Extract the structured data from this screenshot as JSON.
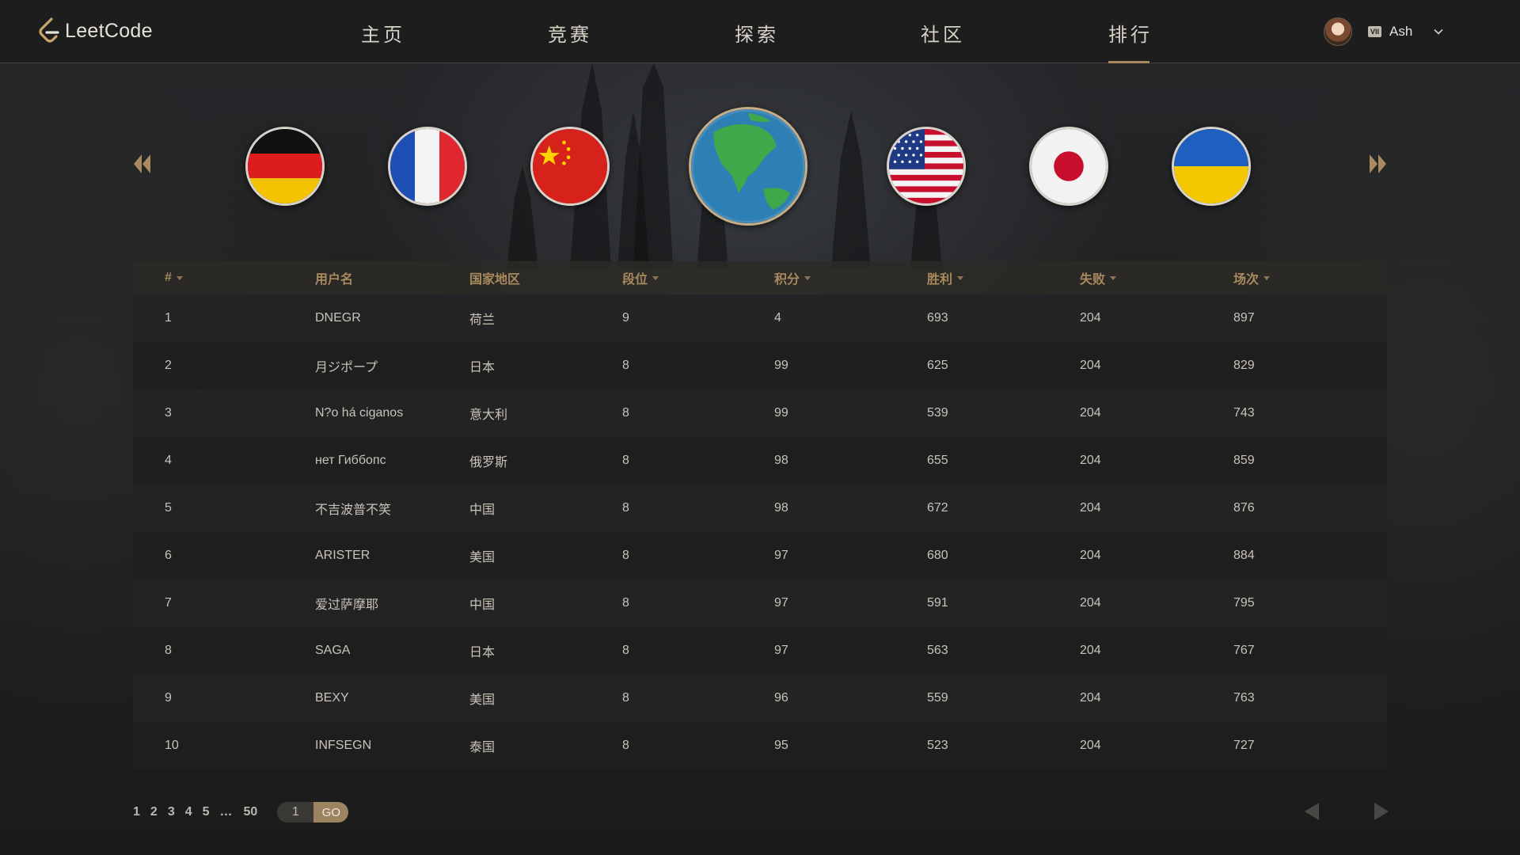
{
  "brand": {
    "name": "LeetCode",
    "accent": "#a88a5e"
  },
  "nav": {
    "items": [
      {
        "label": "主页"
      },
      {
        "label": "竞赛"
      },
      {
        "label": "探索"
      },
      {
        "label": "社区"
      },
      {
        "label": "排行",
        "active": true
      }
    ]
  },
  "user": {
    "badge": "VII",
    "name": "Ash"
  },
  "regions": [
    "germany-flag",
    "france-flag",
    "china-flag",
    "globe",
    "usa-flag",
    "japan-flag",
    "ukraine-flag"
  ],
  "table": {
    "headers": [
      "#",
      "用户名",
      "国家地区",
      "段位",
      "积分",
      "胜利",
      "失败",
      "场次"
    ],
    "rows": [
      [
        "1",
        "DNEGR",
        "荷兰",
        "9",
        "4",
        "693",
        "204",
        "897"
      ],
      [
        "2",
        "月ジポープ",
        "日本",
        "8",
        "99",
        "625",
        "204",
        "829"
      ],
      [
        "3",
        "N?o há ciganos",
        "意大利",
        "8",
        "99",
        "539",
        "204",
        "743"
      ],
      [
        "4",
        "нет Гиббопс",
        "俄罗斯",
        "8",
        "98",
        "655",
        "204",
        "859"
      ],
      [
        "5",
        "不吉波普不笑",
        "中国",
        "8",
        "98",
        "672",
        "204",
        "876"
      ],
      [
        "6",
        "ARISTER",
        "美国",
        "8",
        "97",
        "680",
        "204",
        "884"
      ],
      [
        "7",
        "爱过萨摩耶",
        "中国",
        "8",
        "97",
        "591",
        "204",
        "795"
      ],
      [
        "8",
        "SAGA",
        "日本",
        "8",
        "97",
        "563",
        "204",
        "767"
      ],
      [
        "9",
        "BEXY",
        "美国",
        "8",
        "96",
        "559",
        "204",
        "763"
      ],
      [
        "10",
        "INFSEGN",
        "泰国",
        "8",
        "95",
        "523",
        "204",
        "727"
      ]
    ]
  },
  "pagination": {
    "pages": [
      "1",
      "2",
      "3",
      "4",
      "5",
      "…",
      "50"
    ],
    "input_value": "1",
    "go_label": "GO"
  }
}
